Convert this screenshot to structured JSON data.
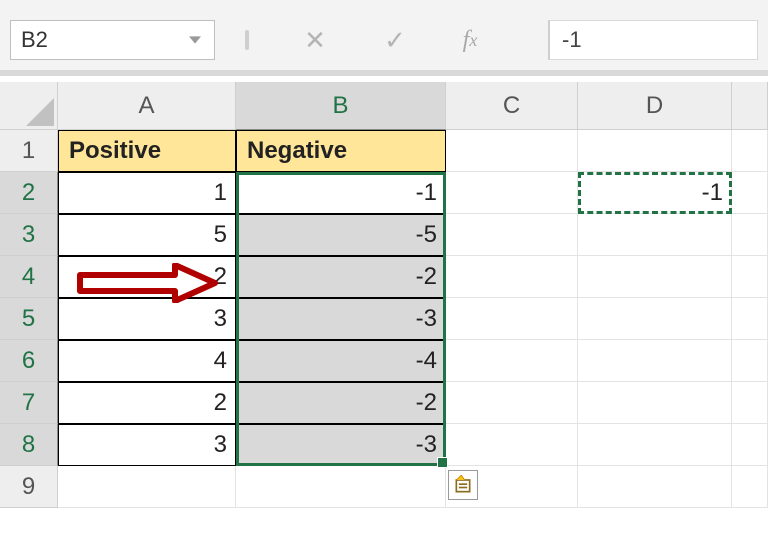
{
  "formula_bar": {
    "name_box": "B2",
    "cancel_glyph": "✕",
    "enter_glyph": "✓",
    "fx_f": "f",
    "fx_x": "x",
    "formula_value": "-1"
  },
  "columns": [
    "A",
    "B",
    "C",
    "D"
  ],
  "rows": [
    "1",
    "2",
    "3",
    "4",
    "5",
    "6",
    "7",
    "8",
    "9"
  ],
  "headers": {
    "A": "Positive",
    "B": "Negative"
  },
  "data": {
    "A": [
      "1",
      "5",
      "2",
      "3",
      "4",
      "2",
      "3"
    ],
    "B": [
      "-1",
      "-5",
      "-2",
      "-3",
      "-4",
      "-2",
      "-3"
    ],
    "D2": "-1"
  },
  "chart_data": {
    "type": "table",
    "title": "",
    "columns": [
      "Positive",
      "Negative"
    ],
    "rows": [
      {
        "Positive": 1,
        "Negative": -1
      },
      {
        "Positive": 5,
        "Negative": -5
      },
      {
        "Positive": 2,
        "Negative": -2
      },
      {
        "Positive": 3,
        "Negative": -3
      },
      {
        "Positive": 4,
        "Negative": -4
      },
      {
        "Positive": 2,
        "Negative": -2
      },
      {
        "Positive": 3,
        "Negative": -3
      }
    ],
    "selected_range": "B2:B8",
    "active_cell": "B2",
    "copied_cell": {
      "ref": "D2",
      "value": -1
    }
  }
}
